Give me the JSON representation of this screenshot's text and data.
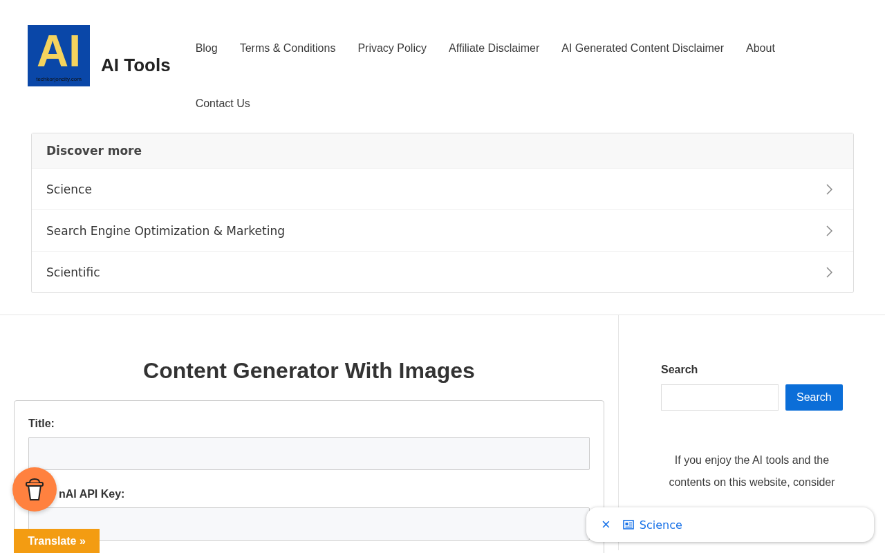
{
  "site": {
    "logo_text": "AI",
    "logo_caption": "techkorjoncity.com",
    "title": "AI Tools"
  },
  "nav": [
    "Blog",
    "Terms & Conditions",
    "Privacy Policy",
    "Affiliate Disclaimer",
    "AI Generated Content Disclaimer",
    "About",
    "Contact Us"
  ],
  "discover": {
    "heading": "Discover more",
    "items": [
      "Science",
      "Search Engine Optimization & Marketing",
      "Scientific"
    ]
  },
  "main": {
    "heading": "Content Generator With Images",
    "fields": [
      {
        "label": "Title:"
      },
      {
        "label": "nAI API Key:"
      }
    ]
  },
  "sidebar": {
    "search_label": "Search",
    "search_button": "Search",
    "message": "If you enjoy the AI tools and the contents on this website, consider"
  },
  "overlays": {
    "translate": "Translate »",
    "chip": {
      "close": "×",
      "label": "Science"
    }
  }
}
